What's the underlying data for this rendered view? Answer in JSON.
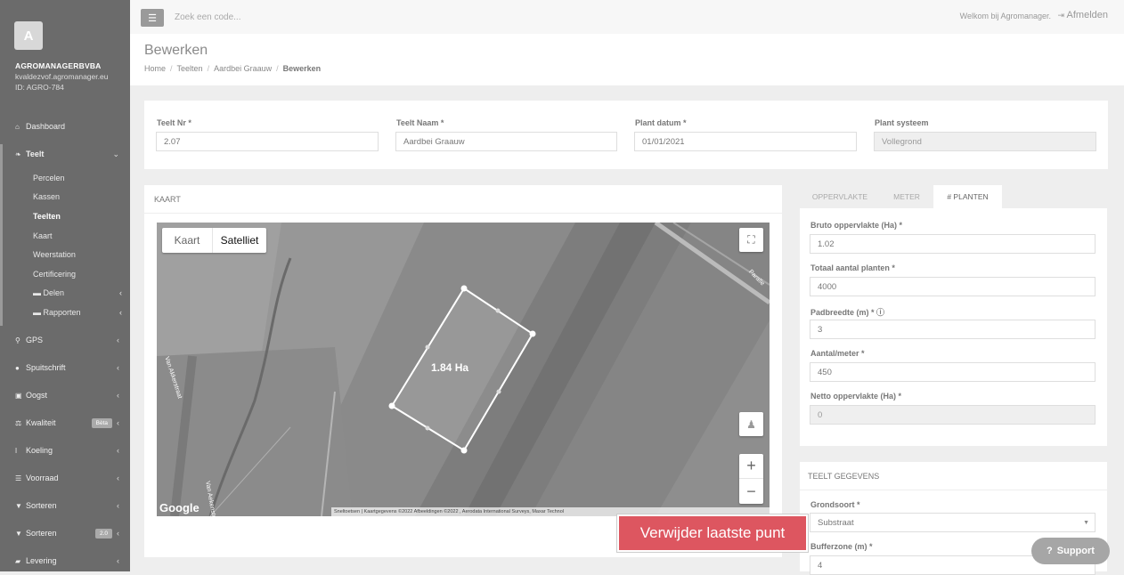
{
  "sidebar": {
    "avatar_letter": "A",
    "company": "AGROMANAGERBVBA",
    "email": "kvaldezvof.agromanager.eu",
    "id_text": "ID: AGRO-784",
    "items": [
      {
        "label": "Dashboard",
        "icon": "home-icon"
      },
      {
        "label": "Teelt",
        "icon": "leaf-icon"
      },
      {
        "label": "GPS",
        "icon": "map-marker-icon"
      },
      {
        "label": "Spuitschrift",
        "icon": "droplet-icon"
      },
      {
        "label": "Oogst",
        "icon": "basket-icon"
      },
      {
        "label": "Kwaliteit",
        "icon": "balance-icon",
        "badge": "Bèta"
      },
      {
        "label": "Koeling",
        "icon": "thermometer-icon"
      },
      {
        "label": "Voorraad",
        "icon": "list-icon"
      },
      {
        "label": "Sorteren",
        "icon": "filter-icon"
      },
      {
        "label": "Sorteren",
        "icon": "filter-icon",
        "badge": "2.0"
      },
      {
        "label": "Levering",
        "icon": "truck-icon"
      }
    ],
    "sub_items": [
      "Percelen",
      "Kassen",
      "Teelten",
      "Kaart",
      "Weerstation",
      "Certificering",
      "Delen",
      "Rapporten"
    ]
  },
  "topbar": {
    "search_placeholder": "Zoek een code...",
    "welcome": "Welkom bij Agromanager.",
    "logout": "Afmelden"
  },
  "page": {
    "title": "Bewerken",
    "breadcrumb": [
      "Home",
      "Teelten",
      "Aardbei Graauw",
      "Bewerken"
    ]
  },
  "form": {
    "teelt_nr_label": "Teelt Nr *",
    "teelt_nr": "2.07",
    "teelt_naam_label": "Teelt Naam *",
    "teelt_naam": "Aardbei Graauw",
    "plant_datum_label": "Plant datum *",
    "plant_datum": "01/01/2021",
    "plant_systeem_label": "Plant systeem",
    "plant_systeem": "Vollegrond"
  },
  "map": {
    "card_title": "KAART",
    "type_kaart": "Kaart",
    "type_satelliet": "Satelliet",
    "area_label": "1.84 Ha",
    "google": "Google",
    "attribution": "Sneltoetsen | Kaartgegevens ©2022 Afbeeldingen ©2022 , Aerodata International Surveys, Maxar Technol",
    "road_labels": [
      "Van Akkerstraat",
      "Van Aekenstr",
      "Paralle"
    ],
    "zoom_in": "+",
    "zoom_out": "−"
  },
  "tabs": [
    "OPPERVLAKTE",
    "METER",
    "# PLANTEN"
  ],
  "planten": {
    "bruto_label": "Bruto oppervlakte (Ha) *",
    "bruto": "1.02",
    "totaal_label": "Totaal aantal planten *",
    "totaal": "4000",
    "pad_label": "Padbreedte (m) *",
    "pad": "3",
    "aantal_label": "Aantal/meter *",
    "aantal": "450",
    "netto_label": "Netto oppervlakte (Ha) *",
    "netto": "0"
  },
  "teelt_gegevens": {
    "title": "TEELT GEGEVENS",
    "grondsoort_label": "Grondsoort *",
    "grondsoort": "Substraat",
    "bufferzone_label": "Bufferzone (m) *",
    "bufferzone": "4"
  },
  "actions": {
    "remove_last_point": "Verwijder laatste punt",
    "support": "Support"
  }
}
